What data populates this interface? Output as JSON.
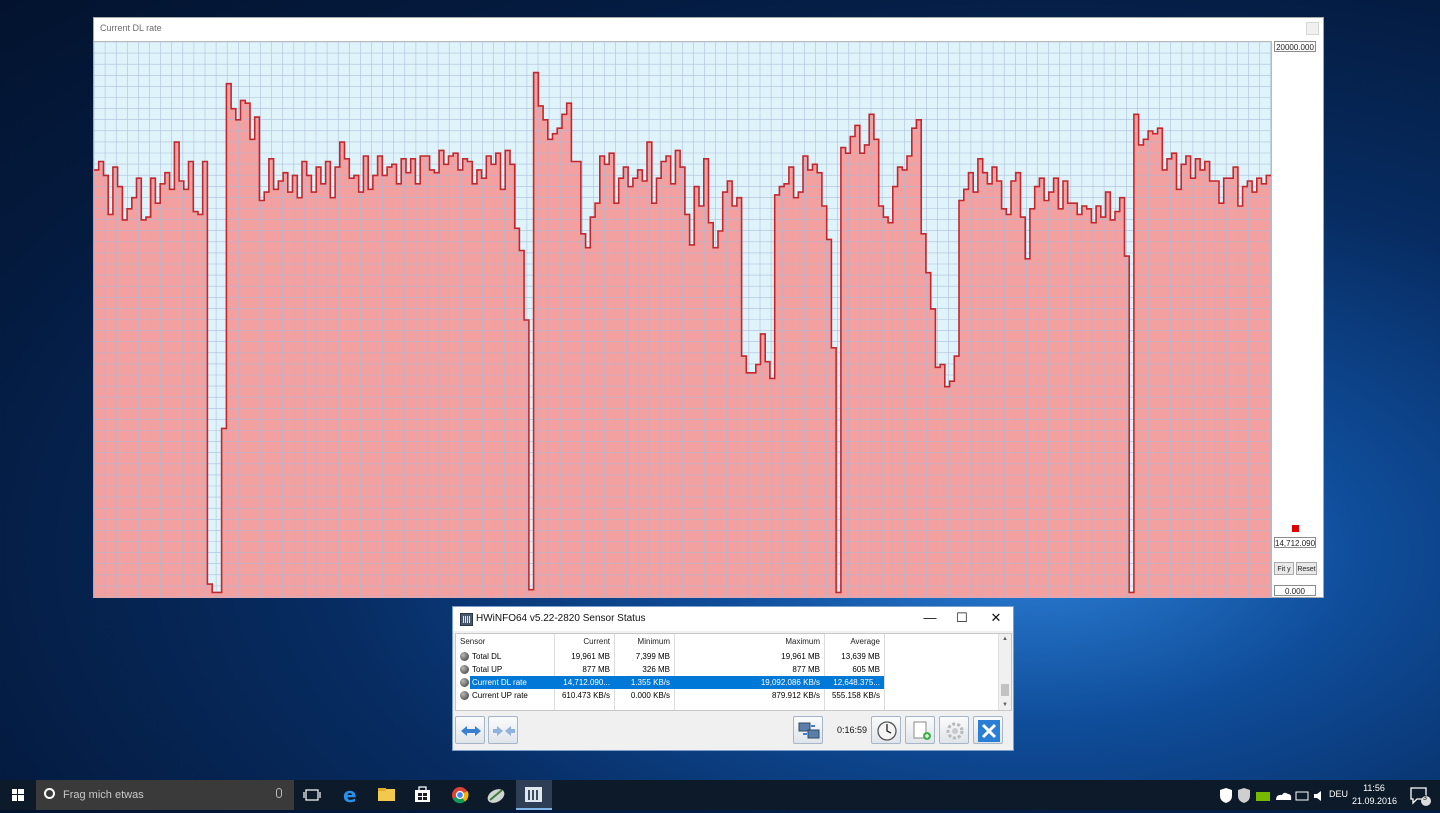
{
  "graph_window": {
    "title": "Current DL rate",
    "max_label": "20000.000",
    "current_label": "14,712.090",
    "min_label": "0.000",
    "fit_y_label": "Fit y",
    "reset_label": "Reset",
    "colors": {
      "fill": "#f3a0a0",
      "line": "#c0282d",
      "background": "#dff4fa",
      "grid": "#a9b9d9"
    },
    "chart_data": {
      "type": "area",
      "ylim": [
        0,
        20000
      ],
      "grid": true,
      "title": "Current DL rate",
      "values": [
        15400,
        15700,
        15200,
        13800,
        15500,
        14800,
        13600,
        14000,
        14400,
        15100,
        13600,
        13700,
        15100,
        14200,
        14900,
        15300,
        14700,
        16400,
        15000,
        14700,
        15700,
        13900,
        13800,
        15700,
        500,
        200,
        200,
        6100,
        18500,
        17600,
        17200,
        17900,
        17800,
        16500,
        17300,
        14300,
        14600,
        15800,
        14700,
        15000,
        15300,
        14600,
        15200,
        14400,
        15700,
        15200,
        14600,
        15500,
        14900,
        15700,
        14400,
        15500,
        16400,
        15800,
        15100,
        15200,
        14600,
        15900,
        14700,
        15200,
        15900,
        15200,
        15500,
        15600,
        14900,
        15800,
        15300,
        15800,
        14900,
        15900,
        15900,
        15400,
        15300,
        16100,
        15600,
        15900,
        16000,
        15400,
        15800,
        15700,
        14900,
        15400,
        15100,
        15900,
        15600,
        16000,
        14700,
        16100,
        15600,
        13300,
        12500,
        10000,
        300,
        18900,
        17700,
        17200,
        16500,
        16700,
        16900,
        17400,
        17800,
        15700,
        15700,
        13100,
        12600,
        13700,
        14200,
        15900,
        15600,
        16000,
        14200,
        15100,
        15500,
        14800,
        15100,
        15400,
        15000,
        16400,
        14200,
        15100,
        15700,
        15900,
        14900,
        16100,
        15500,
        13800,
        12700,
        14800,
        14100,
        15800,
        13500,
        12600,
        13200,
        14600,
        15000,
        14100,
        14400,
        8700,
        8100,
        8100,
        8400,
        9500,
        8500,
        7900,
        14500,
        14800,
        14900,
        15500,
        14400,
        14600,
        15900,
        15400,
        15600,
        15300,
        14100,
        12900,
        9000,
        200,
        16200,
        16000,
        16600,
        17000,
        16000,
        16300,
        17400,
        16500,
        14100,
        13700,
        13500,
        14800,
        15500,
        15400,
        15900,
        16900,
        17200,
        13100,
        11700,
        10400,
        8300,
        8400,
        7600,
        7800,
        8700,
        14300,
        14700,
        15300,
        14600,
        15800,
        15300,
        14900,
        15500,
        15000,
        14000,
        13800,
        15000,
        15300,
        13700,
        12200,
        14000,
        14800,
        15100,
        14300,
        14600,
        15100,
        14000,
        15000,
        14200,
        14200,
        13800,
        14100,
        14000,
        13500,
        14100,
        13700,
        14600,
        13600,
        13900,
        14400,
        12300,
        200,
        17400,
        16300,
        16500,
        16800,
        16700,
        16900,
        15400,
        15800,
        16000,
        14700,
        15600,
        15900,
        15100,
        15800,
        15400,
        15700,
        15000,
        15000,
        14200,
        15100,
        15100,
        15500,
        14100,
        14800,
        15000,
        14600,
        15100,
        14900,
        15200
      ]
    }
  },
  "sensor_window": {
    "title": "HWiNFO64 v5.22-2820 Sensor Status",
    "minimize_label": "—",
    "maximize_label": "☐",
    "close_label": "✕",
    "columns": {
      "sensor": "Sensor",
      "current": "Current",
      "minimum": "Minimum",
      "maximum": "Maximum",
      "average": "Average"
    },
    "rows": [
      {
        "name": "Total DL",
        "current": "19,961 MB",
        "minimum": "7,399 MB",
        "maximum": "19,961 MB",
        "average": "13,639 MB"
      },
      {
        "name": "Total UP",
        "current": "877 MB",
        "minimum": "326 MB",
        "maximum": "877 MB",
        "average": "605 MB"
      },
      {
        "name": "Current DL rate",
        "current": "14,712.090...",
        "minimum": "1.355 KB/s",
        "maximum": "19,092.086 KB/s",
        "average": "12,648.375..."
      },
      {
        "name": "Current UP rate",
        "current": "610.473 KB/s",
        "minimum": "0.000 KB/s",
        "maximum": "879.912 KB/s",
        "average": "555.158 KB/s"
      }
    ],
    "selected_row": "Current DL rate",
    "timer": "0:16:59",
    "toolbar_icons": [
      "expand-arrows-icon",
      "collapse-arrows-icon",
      "network-icon",
      "clock-icon",
      "add-log-icon",
      "settings-gear-icon",
      "close-x-icon"
    ]
  },
  "taskbar": {
    "search_placeholder": "Frag mich etwas",
    "language": "DEU",
    "time": "11:56",
    "date": "21.09.2016",
    "notification_count": "3",
    "apps": [
      "task-view-icon",
      "edge-icon",
      "file-explorer-icon",
      "store-icon",
      "chrome-icon",
      "app-icon",
      "hwinfo-icon"
    ]
  }
}
